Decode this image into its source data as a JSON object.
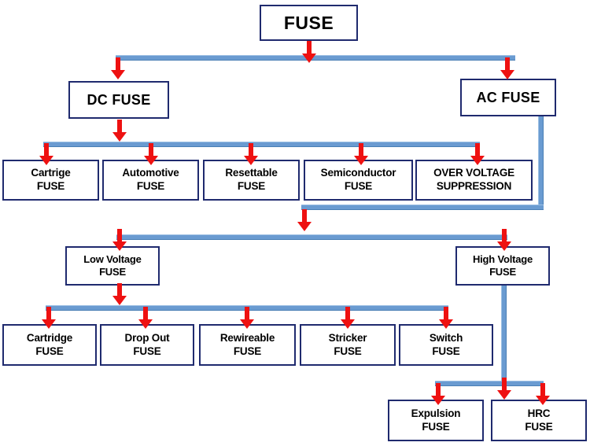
{
  "diagram": {
    "title": "FUSE",
    "colors": {
      "box_border": "#1F2A6E",
      "connector": "#6A9BD1",
      "arrow": "#EE1111",
      "background": "#FFFFFF",
      "text": "#000000"
    },
    "nodes": {
      "root": {
        "line1": "FUSE",
        "line2": ""
      },
      "dc_fuse": {
        "line1": "DC FUSE",
        "line2": ""
      },
      "ac_fuse": {
        "line1": "AC FUSE",
        "line2": ""
      },
      "dc_1": {
        "line1": "Cartrige",
        "line2": "FUSE"
      },
      "dc_2": {
        "line1": "Automotive",
        "line2": "FUSE"
      },
      "dc_3": {
        "line1": "Resettable",
        "line2": "FUSE"
      },
      "dc_4": {
        "line1": "Semiconductor",
        "line2": "FUSE"
      },
      "dc_5": {
        "line1": "OVER VOLTAGE",
        "line2": "SUPPRESSION"
      },
      "low_voltage": {
        "line1": "Low Voltage",
        "line2": "FUSE"
      },
      "high_voltage": {
        "line1": "High Voltage",
        "line2": "FUSE"
      },
      "lv_1": {
        "line1": "Cartridge",
        "line2": "FUSE"
      },
      "lv_2": {
        "line1": "Drop Out",
        "line2": "FUSE"
      },
      "lv_3": {
        "line1": "Rewireable",
        "line2": "FUSE"
      },
      "lv_4": {
        "line1": "Stricker",
        "line2": "FUSE"
      },
      "lv_5": {
        "line1": "Switch",
        "line2": "FUSE"
      },
      "hv_1": {
        "line1": "Expulsion",
        "line2": "FUSE"
      },
      "hv_2": {
        "line1": "HRC",
        "line2": "FUSE"
      }
    },
    "chart_data": {
      "type": "tree",
      "title": "FUSE",
      "root": "FUSE",
      "edges": [
        [
          "FUSE",
          "DC FUSE"
        ],
        [
          "FUSE",
          "AC FUSE"
        ],
        [
          "DC FUSE",
          "Cartrige FUSE"
        ],
        [
          "DC FUSE",
          "Automotive FUSE"
        ],
        [
          "DC FUSE",
          "Resettable FUSE"
        ],
        [
          "DC FUSE",
          "Semiconductor FUSE"
        ],
        [
          "DC FUSE",
          "OVER VOLTAGE SUPPRESSION"
        ],
        [
          "AC FUSE",
          "Low Voltage FUSE"
        ],
        [
          "AC FUSE",
          "High Voltage FUSE"
        ],
        [
          "Low Voltage FUSE",
          "Cartridge FUSE"
        ],
        [
          "Low Voltage FUSE",
          "Drop Out FUSE"
        ],
        [
          "Low Voltage FUSE",
          "Rewireable FUSE"
        ],
        [
          "Low Voltage FUSE",
          "Stricker FUSE"
        ],
        [
          "Low Voltage FUSE",
          "Switch FUSE"
        ],
        [
          "High Voltage FUSE",
          "Expulsion FUSE"
        ],
        [
          "High Voltage FUSE",
          "HRC FUSE"
        ]
      ]
    }
  }
}
